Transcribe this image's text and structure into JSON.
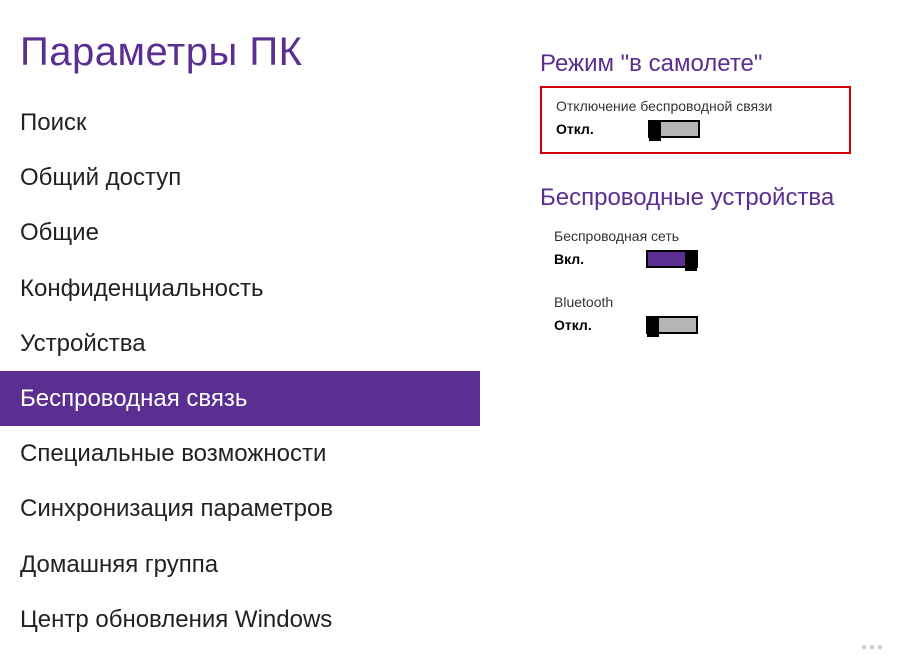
{
  "page_title": "Параметры ПК",
  "sidebar": {
    "items": [
      {
        "label": "Поиск"
      },
      {
        "label": "Общий доступ"
      },
      {
        "label": "Общие"
      },
      {
        "label": "Конфиденциальность"
      },
      {
        "label": "Устройства"
      },
      {
        "label": "Беспроводная связь",
        "selected": true
      },
      {
        "label": "Специальные возможности"
      },
      {
        "label": "Синхронизация параметров"
      },
      {
        "label": "Домашняя группа"
      },
      {
        "label": "Центр обновления Windows"
      }
    ]
  },
  "sections": {
    "airplane": {
      "title": "Режим \"в самолете\"",
      "toggle": {
        "label": "Отключение беспроводной связи",
        "state_text": "Откл.",
        "on": false
      },
      "highlighted": true
    },
    "wireless": {
      "title": "Беспроводные устройства",
      "toggles": [
        {
          "label": "Беспроводная сеть",
          "state_text": "Вкл.",
          "on": true
        },
        {
          "label": "Bluetooth",
          "state_text": "Откл.",
          "on": false
        }
      ]
    }
  }
}
